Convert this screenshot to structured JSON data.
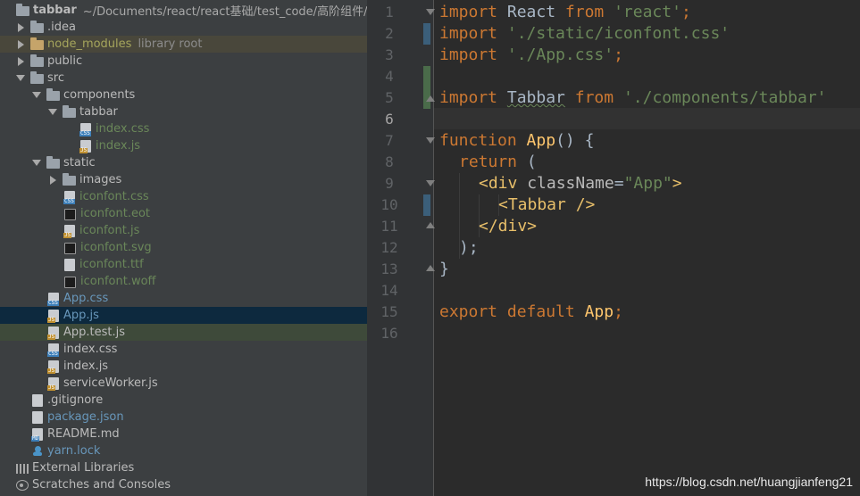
{
  "project": {
    "root_name": "tabbar",
    "root_path": "~/Documents/react/react基础/test_code/高阶组件/tabb",
    "items": [
      {
        "label": ".idea",
        "type": "folder"
      },
      {
        "label": "node_modules",
        "hint": "library root",
        "type": "folder"
      },
      {
        "label": "public",
        "type": "folder"
      },
      {
        "label": "src",
        "type": "folder"
      },
      {
        "label": "components",
        "type": "folder"
      },
      {
        "label": "tabbar",
        "type": "folder"
      },
      {
        "label": "index.css",
        "type": "css"
      },
      {
        "label": "index.js",
        "type": "js"
      },
      {
        "label": "static",
        "type": "folder"
      },
      {
        "label": "images",
        "type": "folder"
      },
      {
        "label": "iconfont.css",
        "type": "css"
      },
      {
        "label": "iconfont.eot",
        "type": "eot"
      },
      {
        "label": "iconfont.js",
        "type": "js"
      },
      {
        "label": "iconfont.svg",
        "type": "svg"
      },
      {
        "label": "iconfont.ttf",
        "type": "ttf"
      },
      {
        "label": "iconfont.woff",
        "type": "woff"
      },
      {
        "label": "App.css",
        "type": "css"
      },
      {
        "label": "App.js",
        "type": "js"
      },
      {
        "label": "App.test.js",
        "type": "test"
      },
      {
        "label": "index.css",
        "type": "css"
      },
      {
        "label": "index.js",
        "type": "js"
      },
      {
        "label": "serviceWorker.js",
        "type": "js"
      },
      {
        "label": ".gitignore",
        "type": "file"
      },
      {
        "label": "package.json",
        "type": "json"
      },
      {
        "label": "README.md",
        "type": "md"
      },
      {
        "label": "yarn.lock",
        "type": "yarn"
      },
      {
        "label": "External Libraries",
        "type": "libs"
      },
      {
        "label": "Scratches and Consoles",
        "type": "scratch"
      }
    ]
  },
  "editor": {
    "line_numbers": [
      "1",
      "2",
      "3",
      "4",
      "5",
      "6",
      "7",
      "8",
      "9",
      "10",
      "11",
      "12",
      "13",
      "14",
      "15",
      "16"
    ],
    "code": {
      "l1_kw": "import",
      "l1_id": " React ",
      "l1_from": "from",
      "l1_str": " 'react'",
      "l1_semi": ";",
      "l2_kw": "import",
      "l2_str": " './static/iconfont.css'",
      "l3_kw": "import",
      "l3_str": " './App.css'",
      "l3_semi": ";",
      "l5_kw": "import",
      "l5_id": "Tabbar",
      "l5_from": "from",
      "l5_str": " './components/tabbar'",
      "l7_kw": "function",
      "l7_fn": "App",
      "l7_rest": "() {",
      "l8_kw": "return",
      "l8_rest": " (",
      "l9_open": "<div",
      "l9_attr": " className",
      "l9_eq": "=",
      "l9_str": "\"App\"",
      "l9_close": ">",
      "l10_tag": "<Tabbar />",
      "l11_tag": "</div>",
      "l12": ");",
      "l13": "}",
      "l15_kw": "export default",
      "l15_id": "App",
      "l15_semi": ";"
    }
  },
  "watermark": "https://blog.csdn.net/huangjianfeng21"
}
